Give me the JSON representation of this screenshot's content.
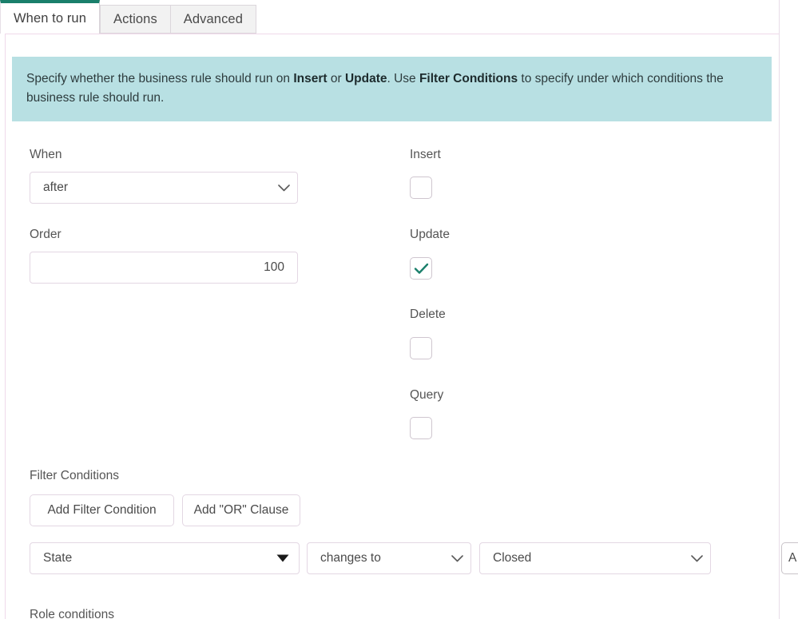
{
  "tabs": [
    {
      "label": "When to run",
      "active": true
    },
    {
      "label": "Actions",
      "active": false
    },
    {
      "label": "Advanced",
      "active": false
    }
  ],
  "banner": {
    "line1_a": "Specify whether the business rule should run on ",
    "line1_b": "Insert",
    "line1_c": " or ",
    "line1_d": "Update",
    "line1_e": ". Use ",
    "line1_f": "Filter Conditions",
    "line1_g": " to specify under which conditions",
    "line2": "the business rule should run."
  },
  "form": {
    "when": {
      "label": "When",
      "value": "after",
      "icon": "chevron-down-icon"
    },
    "order": {
      "label": "Order",
      "value": "100"
    },
    "insert": {
      "label": "Insert",
      "checked": false
    },
    "update": {
      "label": "Update",
      "checked": true
    },
    "delete": {
      "label": "Delete",
      "checked": false
    },
    "query": {
      "label": "Query",
      "checked": false
    }
  },
  "filter_conditions": {
    "label": "Filter Conditions",
    "add_filter_button": "Add Filter Condition",
    "add_or_button": "Add \"OR\" Clause",
    "row": {
      "field": "State",
      "field_icon": "caret-down-icon",
      "operator": "changes to",
      "operator_icon": "chevron-down-icon",
      "value": "Closed",
      "value_icon": "chevron-down-icon"
    },
    "edge_button": "A"
  },
  "role_conditions": {
    "label": "Role conditions"
  },
  "colors": {
    "active_tab_accent": "#1a7f6b",
    "banner_bg": "#b8e0e3",
    "checkmark": "#1a7f6b",
    "border": "#e3d7e3",
    "text": "#555555"
  }
}
